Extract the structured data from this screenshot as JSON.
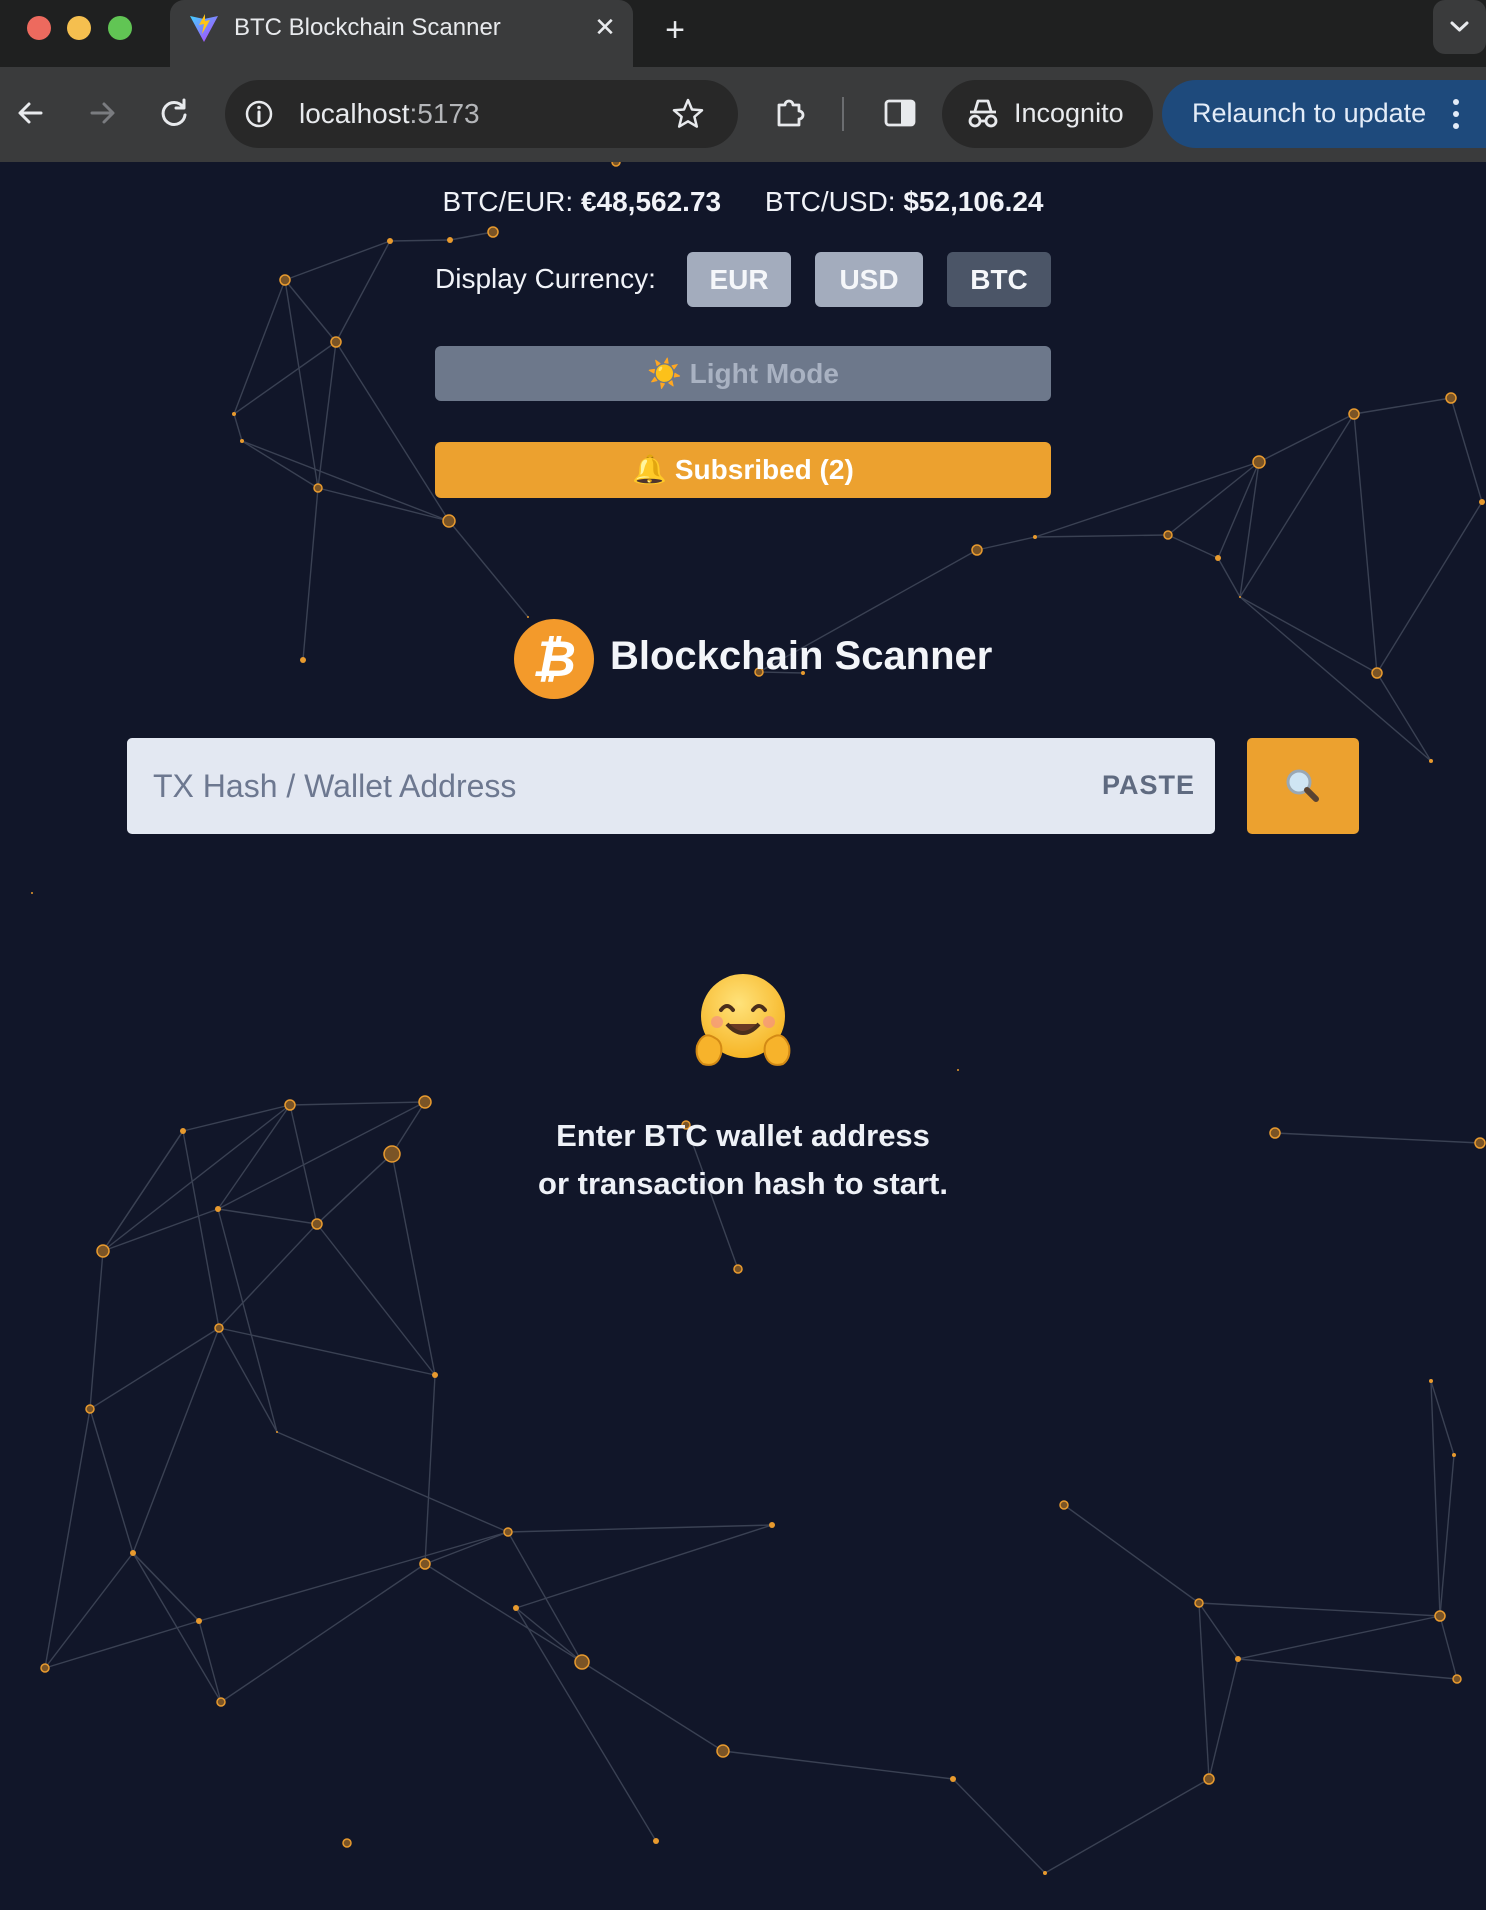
{
  "browser": {
    "tab_title": "BTC Blockchain Scanner",
    "url_host": "localhost",
    "url_port": ":5173",
    "incognito_label": "Incognito",
    "relaunch_label": "Relaunch to update"
  },
  "rates": {
    "eur_label": "BTC/EUR:",
    "eur_value": "€48,562.73",
    "usd_label": "BTC/USD:",
    "usd_value": "$52,106.24"
  },
  "currency": {
    "label": "Display Currency:",
    "options": [
      "EUR",
      "USD",
      "BTC"
    ]
  },
  "light_mode_label": "☀️ Light Mode",
  "subscribed_label": "🔔 Subsribed (2)",
  "brand_title": "Blockchain Scanner",
  "search": {
    "placeholder": "TX Hash / Wallet Address",
    "paste_label": "PASTE",
    "button_icon": "magnifier-icon"
  },
  "empty_state": {
    "emoji": "hugging-face-icon",
    "line1": "Enter BTC wallet address",
    "line2": "or transaction hash to start."
  },
  "colors": {
    "background": "#111629",
    "accent": "#eca12f",
    "node": "#e89a2e",
    "edge": "#3a4153",
    "chrome_relaunch": "#1e4a7c"
  }
}
